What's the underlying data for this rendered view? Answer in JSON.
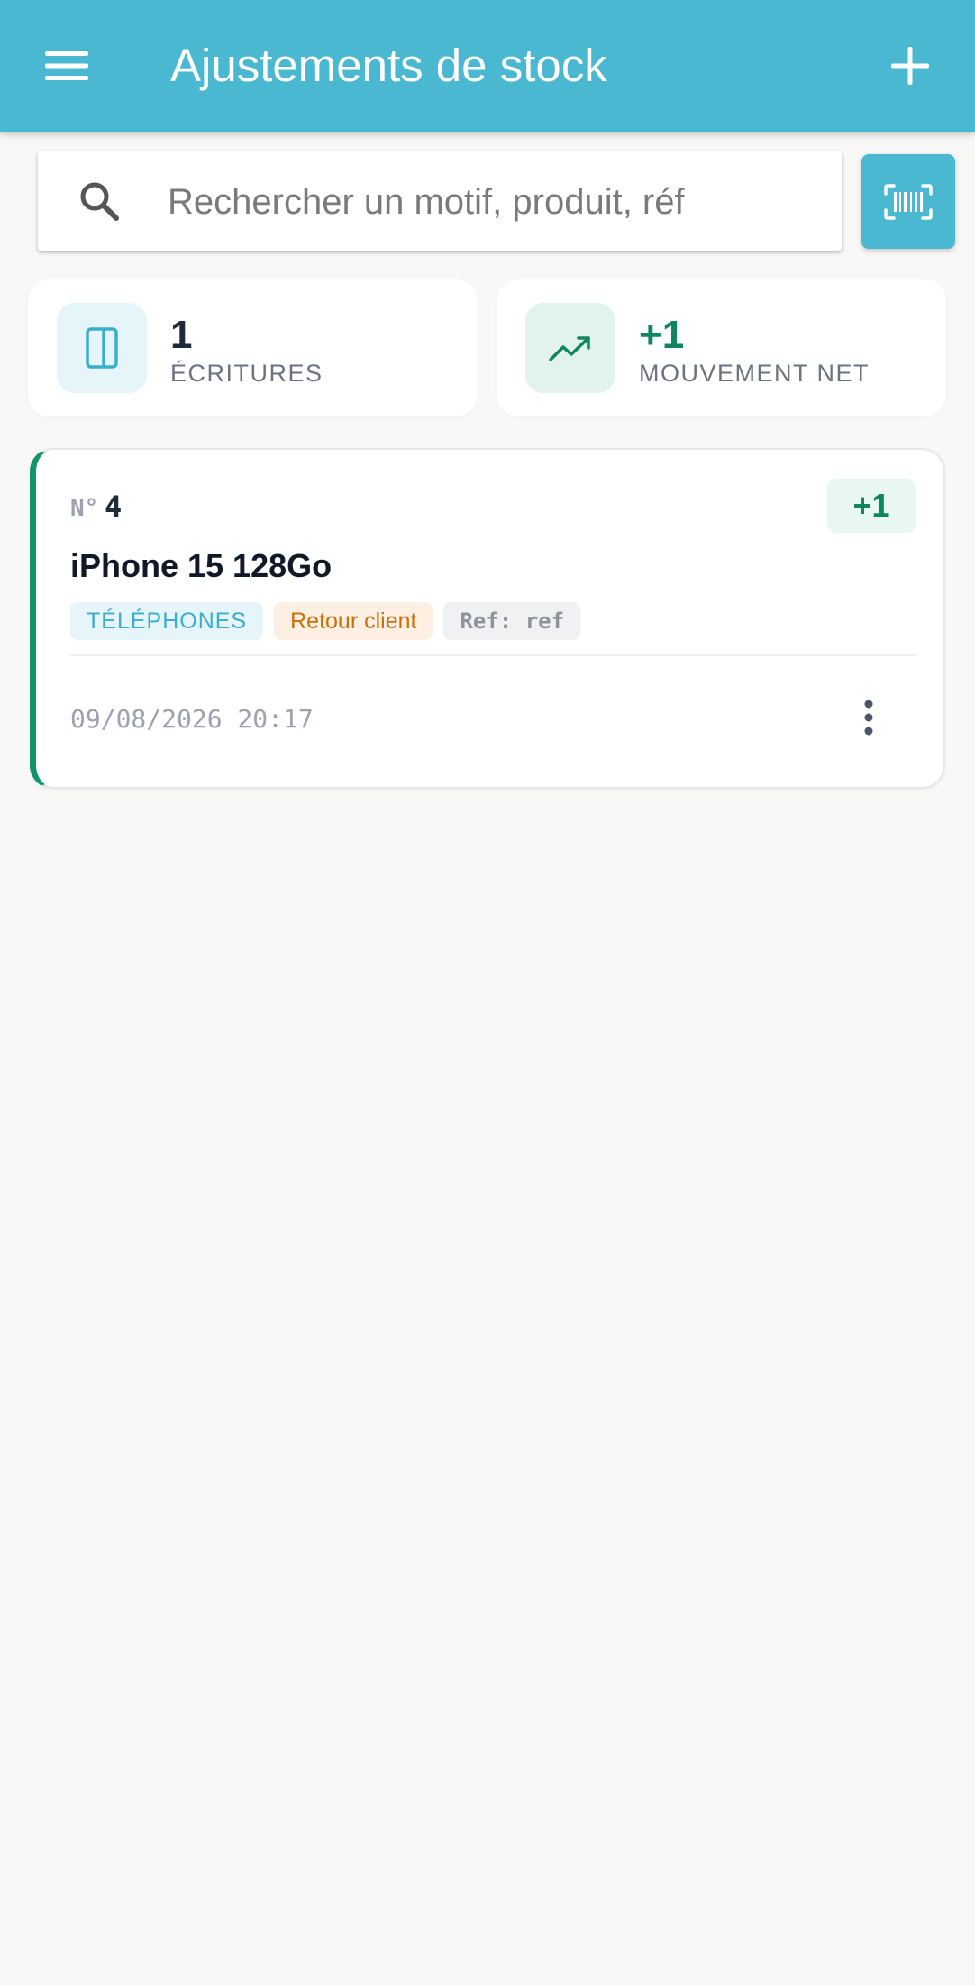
{
  "appbar": {
    "title": "Ajustements de stock",
    "menu_icon": "menu-icon",
    "add_icon": "plus-icon",
    "color": "#4ab8d1"
  },
  "search": {
    "placeholder": "Rechercher un motif, produit, réf",
    "value": "",
    "icon": "search-icon",
    "scan_icon": "barcode-scan-icon"
  },
  "stats": [
    {
      "value": "1",
      "label": "ÉCRITURES",
      "icon": "book-icon",
      "value_color": "#1f2937",
      "icon_bg": "#e6f5fa"
    },
    {
      "value": "+1",
      "label": "MOUVEMENT NET",
      "icon": "trending-up-icon",
      "value_color": "#10865e",
      "icon_bg": "#e2f2ec"
    }
  ],
  "entries": [
    {
      "number_prefix": "N°",
      "number": "4",
      "quantity": "+1",
      "product": "iPhone 15 128Go",
      "category": "TÉLÉPHONES",
      "reason": "Retour client",
      "reference": "Ref: ref",
      "timestamp": "09/08/2026 20:17",
      "accent_color": "#10956a"
    }
  ]
}
